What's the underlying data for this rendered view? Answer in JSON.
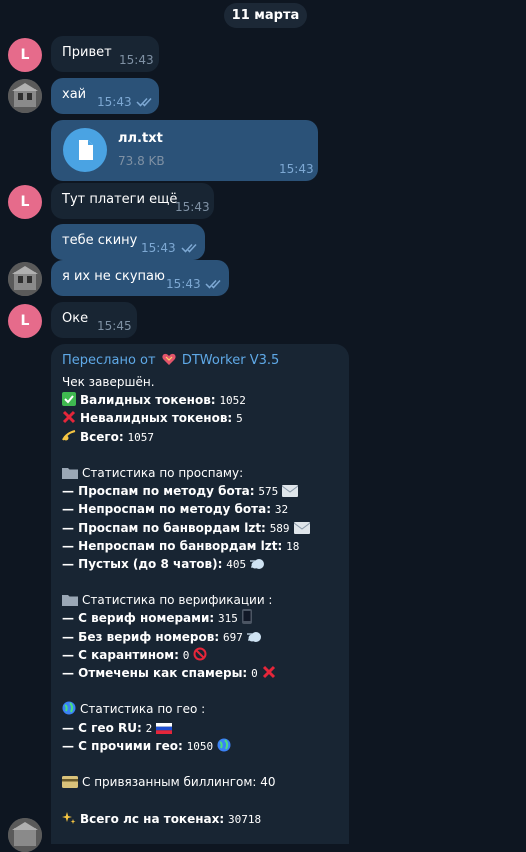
{
  "date_label": "11 марта",
  "contact_initial": "L",
  "messages": [
    {
      "text": "Привет",
      "time": "15:43"
    },
    {
      "text": "хай",
      "time": "15:43"
    },
    {
      "file_name": "лл.txt",
      "file_size": "73.8 KB",
      "time": "15:43"
    },
    {
      "text": "Тут платеги ещё",
      "time": "15:43"
    },
    {
      "text": "тебе скину",
      "time": "15:43"
    },
    {
      "text": "я их не скупаю",
      "time": "15:43"
    },
    {
      "text": "Оке",
      "time": "15:45"
    }
  ],
  "forward": {
    "prefix": "Переслано от",
    "source": "DTWorker V3.5",
    "title": "Чек завершён.",
    "valid_label": "Валидных токенов:",
    "valid_value": "1052",
    "invalid_label": "Невалидных токенов:",
    "invalid_value": "5",
    "total_label": "Всего:",
    "total_value": "1057",
    "spam_header": "Статистика по проспаму:",
    "spam_bot_label": "— Проспам по методу бота:",
    "spam_bot_value": "575",
    "nospam_bot_label": "— Непроспам по методу бота:",
    "nospam_bot_value": "32",
    "spam_lzt_label": "— Проспам по банвордам lzt:",
    "spam_lzt_value": "589",
    "nospam_lzt_label": "— Непроспам по банвордам lzt:",
    "nospam_lzt_value": "18",
    "empty_label": "— Пустых (до 8 чатов):",
    "empty_value": "405",
    "verif_header": "Статистика по верификации :",
    "verif_label": "— С вериф номерами:",
    "verif_value": "315",
    "noverif_label": "— Без вериф номеров:",
    "noverif_value": "697",
    "quarantine_label": "— С карантином:",
    "quarantine_value": "0",
    "spammers_label": "— Отмечены как спамеры:",
    "spammers_value": "0",
    "geo_header": "Статистика по гео :",
    "geo_ru_label": "— С гео RU:",
    "geo_ru_value": "2",
    "geo_other_label": "— С прочими гео:",
    "geo_other_value": "1050",
    "billing_label": "С привязанным биллингом:",
    "billing_value": "40",
    "dialogs_label": "Всего лс на токенах:",
    "dialogs_value": "30718"
  },
  "colors": {
    "background": "#0e1621",
    "incoming_bubble": "#182533",
    "outgoing_bubble": "#2b5278",
    "avatar": "#e66b8b",
    "accent": "#5fa9e7"
  }
}
